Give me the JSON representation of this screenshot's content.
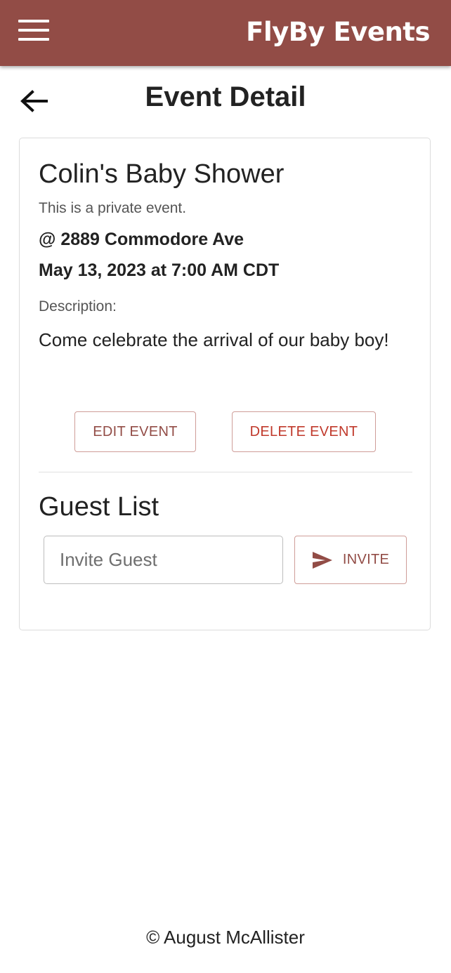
{
  "appbar": {
    "brand": "FlyBy Events",
    "menu_icon": "hamburger-menu-icon",
    "color": "#924c46"
  },
  "header": {
    "back_icon": "arrow-left-icon",
    "title": "Event Detail"
  },
  "event": {
    "title": "Colin's Baby Shower",
    "privacy": "This is a private event.",
    "address": "@ 2889 Commodore Ave",
    "datetime": "May 13, 2023 at 7:00 AM CDT",
    "description_label": "Description:",
    "description": "Come celebrate the arrival of our baby boy!",
    "edit_label": "EDIT EVENT",
    "delete_label": "DELETE EVENT"
  },
  "guests": {
    "title": "Guest List",
    "invite_placeholder": "Invite Guest",
    "invite_label": "INVITE",
    "invite_icon": "send-icon"
  },
  "footer": {
    "text": "© August McAllister"
  }
}
